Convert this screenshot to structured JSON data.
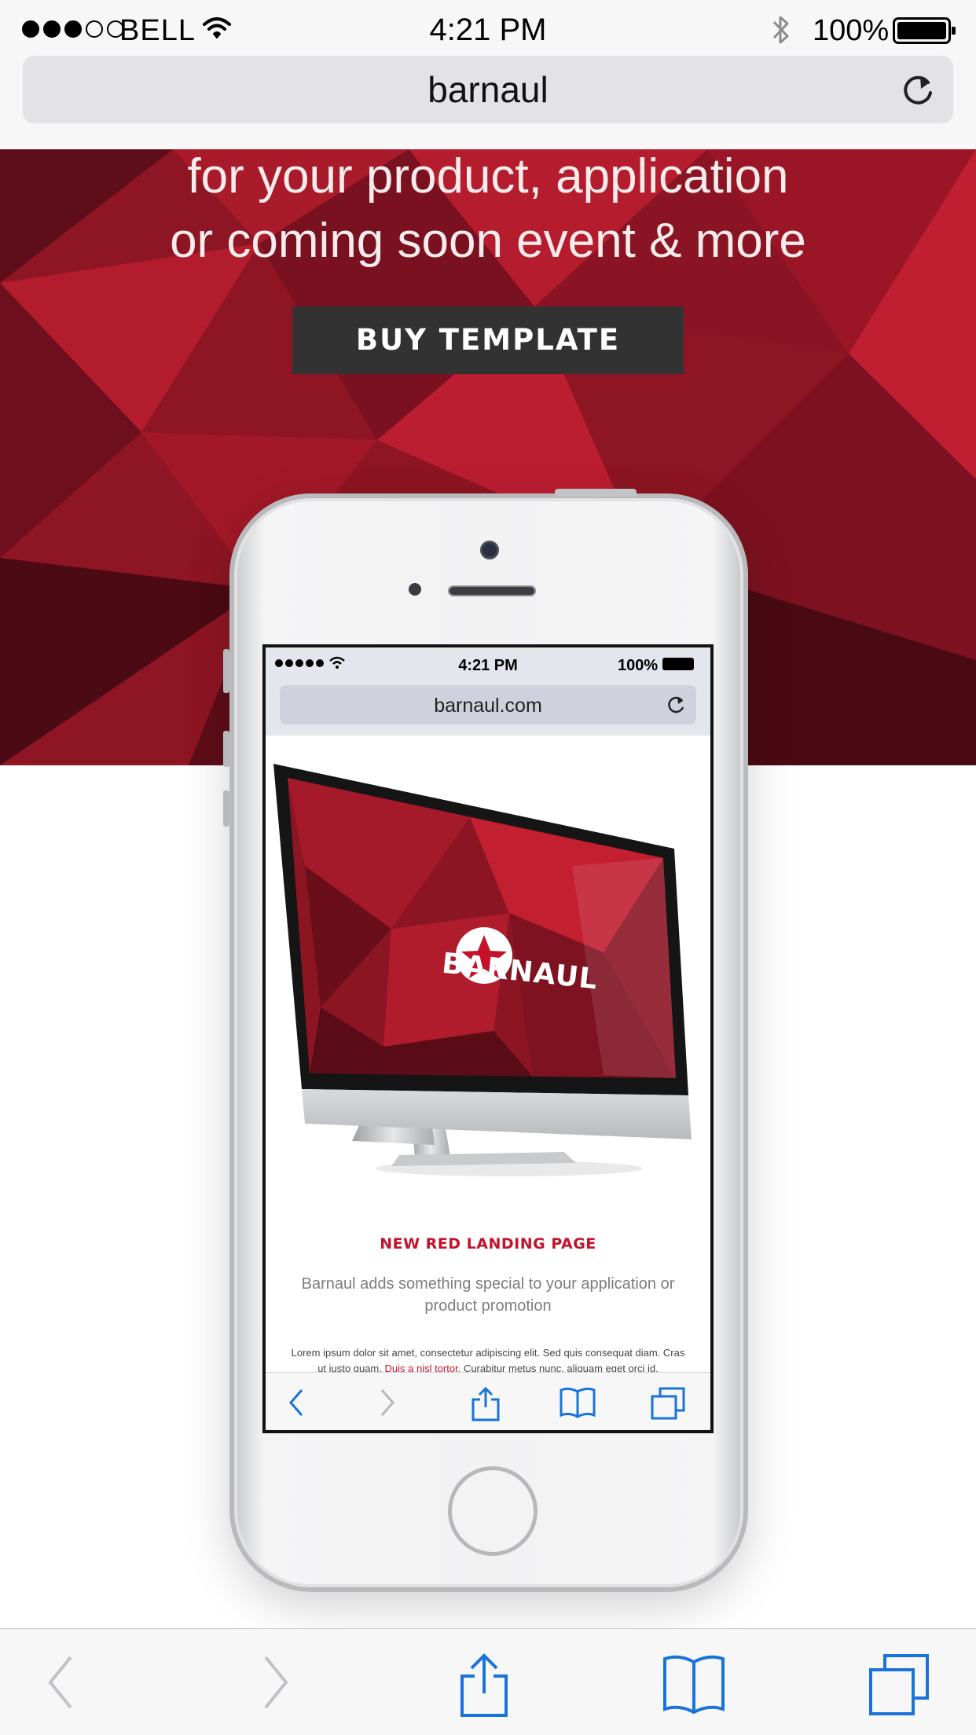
{
  "status_bar": {
    "carrier": "BELL",
    "time": "4:21 PM",
    "battery_percent": "100%",
    "signal_bars_filled": 3,
    "signal_bars_total": 5,
    "icons": [
      "wifi-icon",
      "bluetooth-icon",
      "battery-icon"
    ]
  },
  "address_bar": {
    "url": "barnaul",
    "reload_icon": "reload-icon"
  },
  "hero": {
    "tagline_line1": "for your product, application",
    "tagline_line2": "or coming soon event & more",
    "buy_button": "BUY TEMPLATE",
    "background_color": "#8e1523",
    "button_color": "#333233"
  },
  "mockup": {
    "status_time": "4:21 PM",
    "status_battery": "100%",
    "url": "barnaul.com",
    "brand": "BARNAUL",
    "heading": "NEW RED LANDING PAGE",
    "subtitle": "Barnaul adds something special to your application or product promotion",
    "lorem_a": "Lorem ipsum dolor sit amet, consectetur adipiscing elit. Sed quis consequat diam. Cras ut justo quam. ",
    "lorem_link": "Duis a nisl tortor.",
    "lorem_b": " Curabitur metus nunc, aliquam eget orci id.",
    "accent_color": "#c3122a"
  },
  "toolbar": {
    "items": [
      "back-icon",
      "forward-icon",
      "share-icon",
      "bookmarks-icon",
      "tabs-icon"
    ],
    "tint_color": "#1a73d9"
  }
}
